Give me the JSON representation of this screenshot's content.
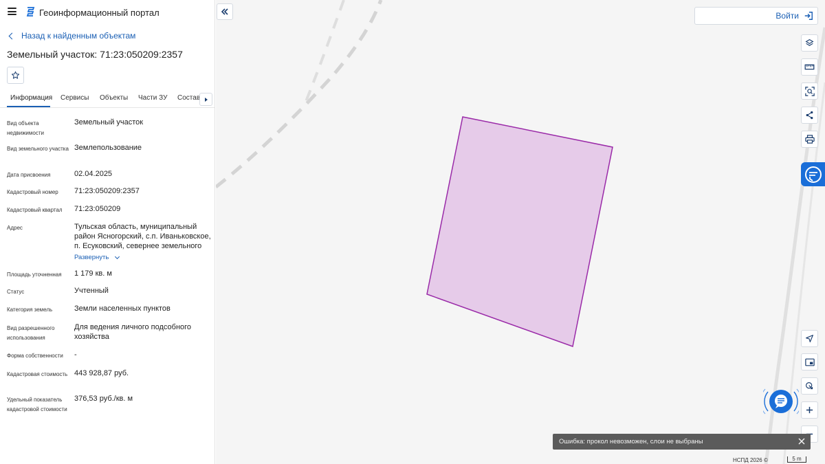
{
  "header": {
    "title": "Геоинформационный портал"
  },
  "nav": {
    "back_label": "Назад к найденным объектам"
  },
  "object": {
    "title": "Земельный участок: 71:23:050209:2357"
  },
  "tabs": [
    {
      "label": "Информация"
    },
    {
      "label": "Сервисы"
    },
    {
      "label": "Объекты"
    },
    {
      "label": "Части ЗУ"
    },
    {
      "label": "Состав"
    }
  ],
  "properties": [
    {
      "label": "Вид объекта недвижимости",
      "value": "Земельный участок"
    },
    {
      "label": "Вид земельного участка",
      "value": "Землепользование"
    },
    {
      "label": "Дата присвоения",
      "value": "02.04.2025"
    },
    {
      "label": "Кадастровый номер",
      "value": "71:23:050209:2357"
    },
    {
      "label": "Кадастровый квартал",
      "value": "71:23:050209"
    },
    {
      "label": "Адрес",
      "value": "Тульская область, муниципальный район Ясногорский, с.п. Иваньковское, п. Есуковский, севернее земельного"
    },
    {
      "label": "Площадь уточненная",
      "value": "1 179 кв. м"
    },
    {
      "label": "Статус",
      "value": "Учтенный"
    },
    {
      "label": "Категория земель",
      "value": "Земли населенных пунктов"
    },
    {
      "label": "Вид разрешенного использования",
      "value": "Для ведения личного подсобного хозяйства"
    },
    {
      "label": "Форма собственности",
      "value": "-"
    },
    {
      "label": "Кадастровая стоимость",
      "value": "443 928,87 руб."
    },
    {
      "label": "Удельный показатель кадастровой стоимости",
      "value": "376,53 руб./кв. м"
    }
  ],
  "address_expand_label": "Развернуть",
  "map": {
    "login_label": "Войти",
    "toast_message": "Ошибка: прокол невозможен, слои не выбраны",
    "attribution": "НСПД 2026 ©",
    "scale_label": "5 m",
    "parcel_fill": "#e6cbe9",
    "parcel_stroke": "#9a2aa8"
  },
  "colors": {
    "accent": "#1a5fb4",
    "side_tab": "#1a6ed8"
  }
}
